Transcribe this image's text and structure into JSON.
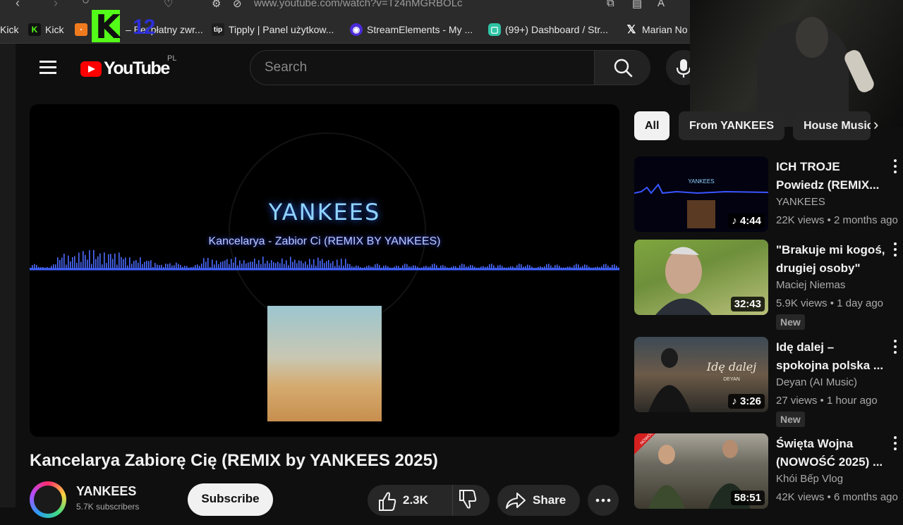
{
  "browser": {
    "url": "www.youtube.com/watch?v=Tz4nMGRBOLc",
    "bookmarks": [
      {
        "label": "Kick",
        "icon": "kick-icon"
      },
      {
        "label": "Kick",
        "icon": "kick-icon"
      },
      {
        "label": "– Bezpłatny zwr...",
        "icon": "orange-icon"
      },
      {
        "label": "Tipply | Panel użytkow...",
        "icon": "tipply-icon"
      },
      {
        "label": "StreamElements - My ...",
        "icon": "streamelements-icon"
      },
      {
        "label": "(99+) Dashboard / Str...",
        "icon": "dashboard-icon"
      },
      {
        "label": "Marian No",
        "icon": "x-icon"
      }
    ],
    "overlay_number": "12"
  },
  "header": {
    "logo_text": "YouTube",
    "region": "PL",
    "search_placeholder": "Search"
  },
  "player": {
    "overlay_title": "YANKEES",
    "overlay_subtitle": "Kancelarya -  Zabior  Ci   (REMIX BY YANKEES)"
  },
  "video": {
    "title": "Kancelarya Zabiorę Cię (REMIX by YANKEES 2025)",
    "channel": "YANKEES",
    "subscribers": "5.7K subscribers",
    "subscribe_label": "Subscribe",
    "likes": "2.3K",
    "share_label": "Share"
  },
  "chips": [
    "All",
    "From YANKEES",
    "House Music"
  ],
  "recommendations": [
    {
      "title_line1": "ICH TROJE",
      "title_line2": "Powiedz  (REMIX...",
      "channel": "YANKEES",
      "meta": "22K views • 2 months ago",
      "duration": "4:44",
      "music": true,
      "badge": ""
    },
    {
      "title_line1": "\"Brakuje mi kogoś,",
      "title_line2": "drugiej osoby\"",
      "channel": "Maciej Niemas",
      "meta": "5.9K views • 1 day ago",
      "duration": "32:43",
      "music": false,
      "badge": "New"
    },
    {
      "title_line1": "Idę dalej –",
      "title_line2": "spokojna polska ...",
      "channel": "Deyan (AI Music)",
      "meta": "27 views • 1 hour ago",
      "duration": "3:26",
      "music": true,
      "badge": "New"
    },
    {
      "title_line1": "Święta Wojna",
      "title_line2": "(NOWOŚĆ 2025) ...",
      "channel": "Khói Bếp Vlog",
      "meta": "42K views • 6 months ago",
      "duration": "58:51",
      "music": false,
      "badge": ""
    }
  ],
  "thumb_text": {
    "t1_top": "YANKEES",
    "t3_script": "Idę dalej",
    "t3_sub": "DEYAN",
    "t4_tag": "NOWOŚĆ"
  }
}
